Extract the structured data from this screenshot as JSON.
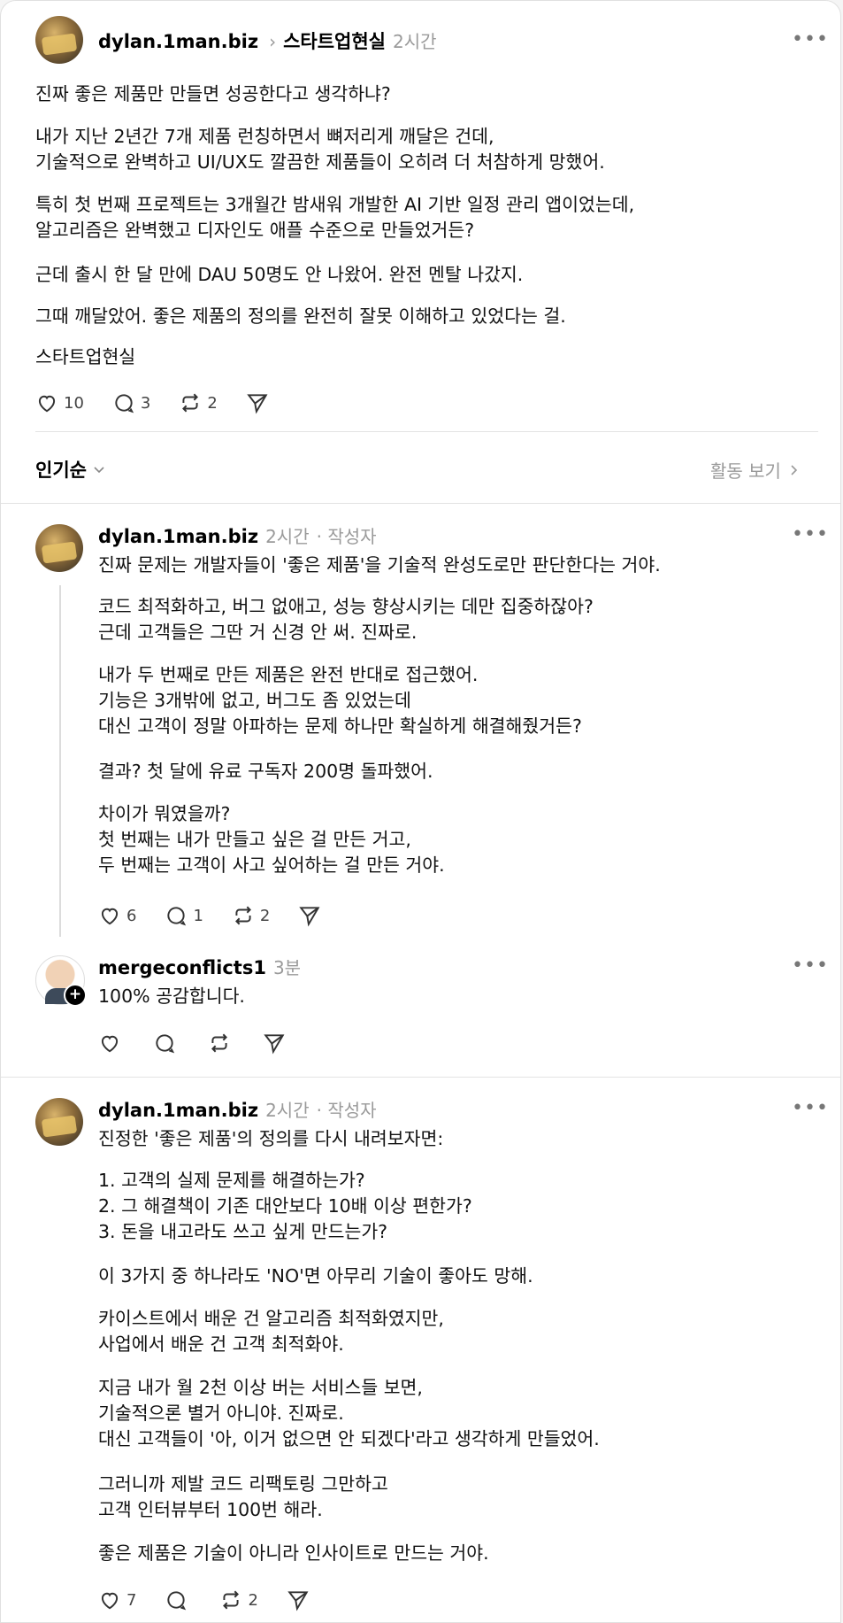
{
  "post": {
    "username": "dylan.1man.biz",
    "community": "스타트업현실",
    "time": "2시간",
    "paragraphs": [
      "진짜 좋은 제품만 만들면 성공한다고 생각하냐?",
      "내가 지난 2년간 7개 제품 런칭하면서 뼈저리게 깨달은 건데,\n기술적으로 완벽하고 UI/UX도 깔끔한 제품들이 오히려 더 처참하게 망했어.",
      "특히 첫 번째 프로젝트는 3개월간 밤새워 개발한 AI 기반 일정 관리 앱이었는데,\n알고리즘은 완벽했고 디자인도 애플 수준으로 만들었거든?",
      "근데 출시 한 달 만에 DAU 50명도 안 나왔어. 완전 멘탈 나갔지.",
      "그때 깨달았어. 좋은 제품의 정의를 완전히 잘못 이해하고 있었다는 걸.",
      "스타트업현실"
    ],
    "likes": "10",
    "replies": "3",
    "reposts": "2"
  },
  "sort": {
    "label": "인기순",
    "activity": "활동 보기"
  },
  "reply1": {
    "username": "dylan.1man.biz",
    "time": "2시간",
    "author_tag": "· 작성자",
    "paragraphs": [
      "진짜 문제는 개발자들이 '좋은 제품'을 기술적 완성도로만 판단한다는 거야.",
      "코드 최적화하고, 버그 없애고, 성능 향상시키는 데만 집중하잖아?\n근데 고객들은 그딴 거 신경 안 써. 진짜로.",
      "내가 두 번째로 만든 제품은 완전 반대로 접근했어.\n기능은 3개밖에 없고, 버그도 좀 있었는데\n대신 고객이 정말 아파하는 문제 하나만 확실하게 해결해줬거든?",
      "결과? 첫 달에 유료 구독자 200명 돌파했어.",
      "차이가 뭐였을까?\n첫 번째는 내가 만들고 싶은 걸 만든 거고,\n두 번째는 고객이 사고 싶어하는 걸 만든 거야."
    ],
    "likes": "6",
    "replies": "1",
    "reposts": "2"
  },
  "reply2": {
    "username": "mergeconflicts1",
    "time": "3분",
    "text": "100% 공감합니다.",
    "plus": "+"
  },
  "reply3": {
    "username": "dylan.1man.biz",
    "time": "2시간",
    "author_tag": "· 작성자",
    "paragraphs": [
      "진정한 '좋은 제품'의 정의를 다시 내려보자면:",
      "1. 고객의 실제 문제를 해결하는가?\n2. 그 해결책이 기존 대안보다 10배 이상 편한가?\n3. 돈을 내고라도 쓰고 싶게 만드는가?",
      "이 3가지 중 하나라도 'NO'면 아무리 기술이 좋아도 망해.",
      "카이스트에서 배운 건 알고리즘 최적화였지만,\n사업에서 배운 건 고객 최적화야.",
      "지금 내가 월 2천 이상 버는 서비스들 보면,\n기술적으론 별거 아니야. 진짜로.\n대신 고객들이 '아, 이거 없으면 안 되겠다'라고 생각하게 만들었어.",
      "그러니까 제발 코드 리팩토링 그만하고\n고객 인터뷰부터 100번 해라.",
      "좋은 제품은 기술이 아니라 인사이트로 만드는 거야."
    ],
    "likes": "7",
    "reposts": "2"
  },
  "icons": {
    "more": "more-dots-icon",
    "like": "heart-icon",
    "reply": "comment-bubble-icon",
    "repost": "repost-icon",
    "share": "send-icon"
  }
}
